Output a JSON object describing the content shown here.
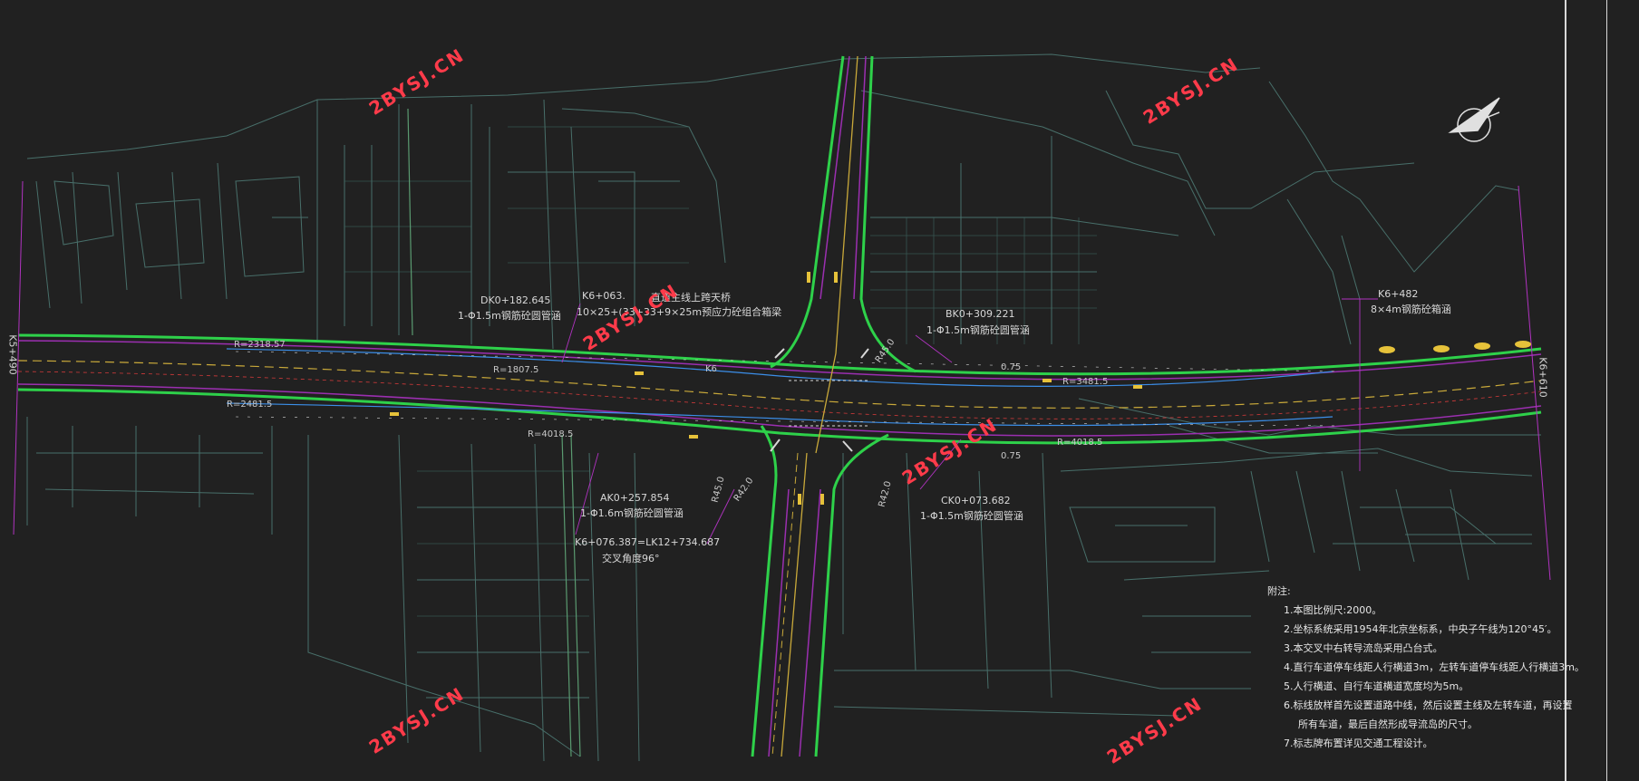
{
  "stations": {
    "left": "K5+490",
    "right": "K6+610"
  },
  "structures": {
    "bridge_station": "K6+063.",
    "bridge_name": "直道主线上跨天桥",
    "bridge_spans": "10×25+(33+33+9×25m预应力砼组合箱梁",
    "culvert_dk": "DK0+182.645",
    "culvert_dk_desc": "1-Φ1.5m钢筋砼圆管涵",
    "culvert_bk": "BK0+309.221",
    "culvert_bk_desc": "1-Φ1.5m钢筋砼圆管涵",
    "culvert_ak": "AK0+257.854",
    "culvert_ak_desc": "1-Φ1.6m钢筋砼圆管涵",
    "culvert_ck": "CK0+073.682",
    "culvert_ck_desc": "1-Φ1.5m钢筋砼圆管涵",
    "box_station": "K6+482",
    "box_desc": "8×4m钢筋砼箱涵",
    "intersection_station": "K6+076.387=LK12+734.687",
    "intersection_angle": "交叉角度96°"
  },
  "road_labels": {
    "curve_r1": "R=2318.57",
    "curve_r2": "R=2481.5",
    "curve_r3": "R=1807.5",
    "curve_r4": "R=4018.5",
    "curve_r5": "R=3481.5",
    "curve_r6": "R=4018.5",
    "radius_a": "R45.0",
    "radius_b": "R42.0",
    "radius_c": "R45.0",
    "radius_d": "R42.0",
    "lane_k6": "K6",
    "dim_075_a": "0.75",
    "dim_075_b": "0.75"
  },
  "watermark": "2BYSJ.CN",
  "notes": {
    "title": "附注:",
    "items": [
      "1.本图比例尺:2000。",
      "2.坐标系统采用1954年北京坐标系，中央子午线为120°45′。",
      "3.本交叉中右转导流岛采用凸台式。",
      "4.直行车道停车线距人行横道3m，左转车道停车线距人行横道3m。",
      "5.人行横道、自行车道横道宽度均为5m。",
      "6.标线放样首先设置道路中线，然后设置主线及左转车道，再设置",
      "所有车道，最后自然形成导流岛的尺寸。",
      "7.标志牌布置详见交通工程设计。"
    ]
  },
  "colors": {
    "background": "#212121",
    "parcel_lines": "#5a8a82",
    "road_edge_green": "#2ed14a",
    "road_inner_magenta": "#9b2fb0",
    "road_centerline": "#c9a93a",
    "lane_blue": "#3b8ee8",
    "annotation_red": "#ff3b4a",
    "text": "#d8d8d8"
  }
}
